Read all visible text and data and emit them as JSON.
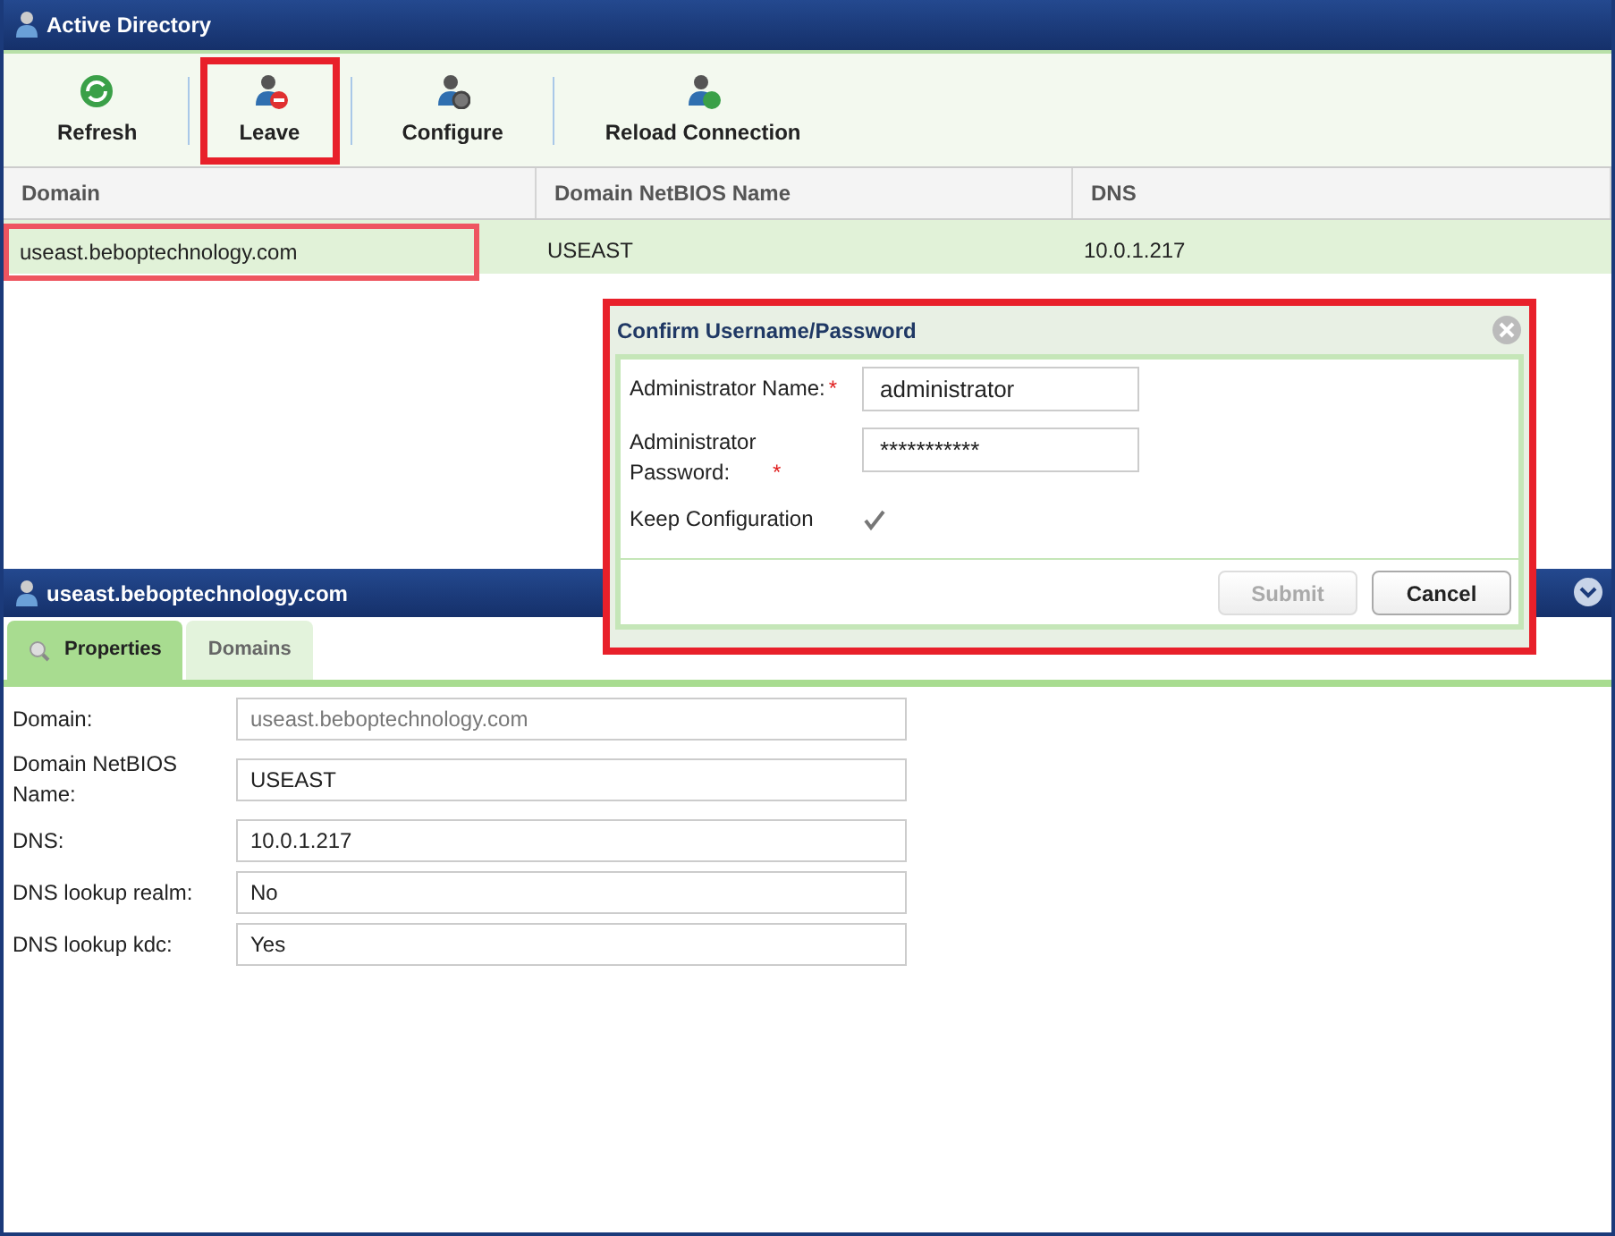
{
  "window": {
    "title": "Active Directory"
  },
  "toolbar": [
    {
      "kind": "refresh",
      "label": "Refresh",
      "highlighted": false
    },
    {
      "kind": "leave",
      "label": "Leave",
      "highlighted": true
    },
    {
      "kind": "configure",
      "label": "Configure",
      "highlighted": false
    },
    {
      "kind": "reload",
      "label": "Reload Connection",
      "highlighted": false
    }
  ],
  "table": {
    "columns": [
      "Domain",
      "Domain NetBIOS Name",
      "DNS"
    ],
    "rows": [
      {
        "cells": [
          "useast.beboptechnology.com",
          "USEAST",
          "10.0.1.217"
        ],
        "selected": true,
        "highlighted": true
      }
    ]
  },
  "dialog": {
    "title": "Confirm Username/Password",
    "highlighted": true,
    "fields": [
      {
        "kind": "text",
        "label": "Administrator Name:",
        "required_mark": "*",
        "value": "administrator"
      },
      {
        "kind": "password",
        "label": "Administrator Password:",
        "required_mark": "*",
        "value": "***********"
      },
      {
        "kind": "checkbox",
        "label": "Keep Configuration",
        "checked": true
      }
    ],
    "buttons": [
      {
        "label": "Submit",
        "disabled": true
      },
      {
        "label": "Cancel",
        "disabled": false
      }
    ]
  },
  "detail": {
    "title": "useast.beboptechnology.com",
    "tabs": [
      {
        "label": "Properties",
        "selected": true
      },
      {
        "label": "Domains",
        "selected": false
      }
    ],
    "fields": [
      {
        "label": "Domain:",
        "value": "useast.beboptechnology.com",
        "obscured": true
      },
      {
        "label": "Domain NetBIOS Name:",
        "value": "USEAST",
        "obscured": false
      },
      {
        "label": "DNS:",
        "value": "10.0.1.217",
        "obscured": false
      },
      {
        "label": "DNS lookup realm:",
        "value": "No",
        "obscured": false
      },
      {
        "label": "DNS lookup kdc:",
        "value": "Yes",
        "obscured": false
      }
    ]
  }
}
